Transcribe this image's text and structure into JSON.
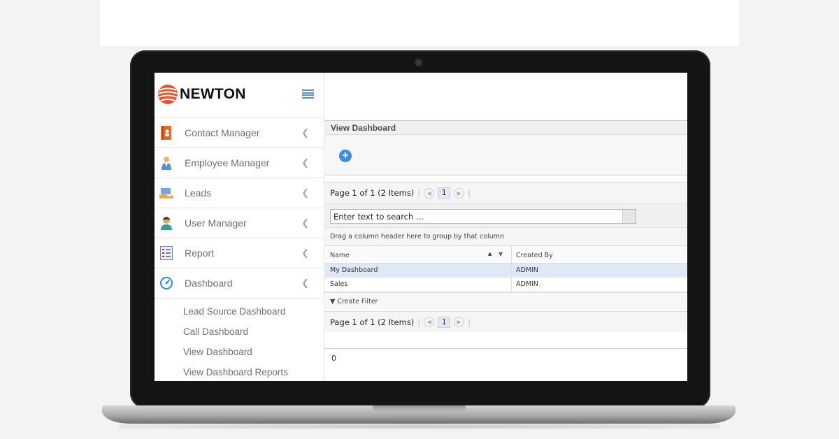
{
  "app": {
    "logo_text": "NEWTON",
    "accent_color": "#3a8ee6",
    "logo_colors": [
      "#e8552a",
      "#c9341f"
    ]
  },
  "sidebar": {
    "items": [
      {
        "label": "Contact Manager",
        "icon": "contact-book-icon"
      },
      {
        "label": "Employee Manager",
        "icon": "employee-icon"
      },
      {
        "label": "Leads",
        "icon": "leads-handshake-icon"
      },
      {
        "label": "User Manager",
        "icon": "user-icon"
      },
      {
        "label": "Report",
        "icon": "report-icon"
      },
      {
        "label": "Dashboard",
        "icon": "dashboard-gauge-icon"
      }
    ],
    "submenu": [
      "Lead Source Dashboard",
      "Call Dashboard",
      "View Dashboard",
      "View Dashboard Reports"
    ]
  },
  "main": {
    "panel_title": "View Dashboard",
    "add_icon": "plus-circle-icon",
    "pager": {
      "text": "Page 1 of 1 (2 Items)",
      "current_page": "1"
    },
    "search_placeholder": "Enter text to search ...",
    "group_hint": "Drag a column header here to group by that column",
    "columns": [
      "Name",
      "Created By"
    ],
    "rows": [
      {
        "name": "My Dashboard",
        "created_by": "ADMIN",
        "selected": true
      },
      {
        "name": "Sales",
        "created_by": "ADMIN",
        "selected": false
      }
    ],
    "filter_label": "Create Filter",
    "footer_value": "0"
  }
}
